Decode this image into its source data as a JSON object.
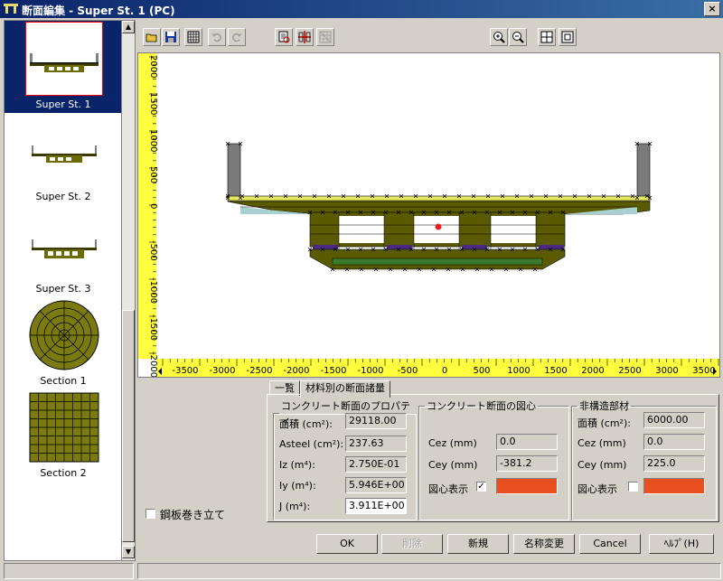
{
  "window": {
    "title": "断面編集 - Super St. 1 (PC)",
    "close": "×"
  },
  "sidebar": {
    "items": [
      {
        "label": "Super St. 1",
        "selected": true
      },
      {
        "label": "Super St. 2",
        "selected": false
      },
      {
        "label": "Super St. 3",
        "selected": false
      },
      {
        "label": "Section 1",
        "selected": false
      },
      {
        "label": "Section 2",
        "selected": false
      }
    ]
  },
  "toolbar": {
    "icons": [
      "open-icon",
      "save-icon",
      "grid-icon",
      "undo-icon",
      "redo-icon",
      "properties-icon",
      "center-icon",
      "mesh-icon",
      "zoom-in-icon",
      "zoom-out-icon",
      "fit-icon",
      "extent-icon"
    ]
  },
  "canvas": {
    "y_ruler": [
      "2000",
      "1500",
      "1000",
      "500",
      "0",
      "-500",
      "-1000",
      "-1500",
      "-2000"
    ],
    "x_ruler": [
      "-3500",
      "-3000",
      "-2500",
      "-2000",
      "-1500",
      "-1000",
      "-500",
      "0",
      "500",
      "1000",
      "1500",
      "2000",
      "2500",
      "3000",
      "3500"
    ]
  },
  "tabs": {
    "list": "一覧",
    "materials": "材料別の断面諸量"
  },
  "steel_wrap": {
    "label": "鋼板巻き立て",
    "checked": false
  },
  "concrete_props": {
    "legend": "コンクリート断面のプロパティ",
    "area_label": "面積 (cm²):",
    "area_value": "29118.00",
    "asteel_label": "Asteel (cm²):",
    "asteel_value": "237.63",
    "iz_label": "Iz (m⁴):",
    "iz_value": "2.750E-01",
    "iy_label": "Iy (m⁴):",
    "iy_value": "5.946E+00",
    "j_label": "J (m⁴):",
    "j_value": "3.911E+00"
  },
  "concrete_centroid": {
    "legend": "コンクリート断面の図心",
    "cez_label": "Cez (mm)",
    "cez_value": "0.0",
    "cey_label": "Cey (mm)",
    "cey_value": "-381.2",
    "show_label": "図心表示",
    "show_checked": true,
    "color": "#e85020"
  },
  "nonstructural": {
    "legend": "非構造部材",
    "area_label": "面積 (cm²):",
    "area_value": "6000.00",
    "cez_label": "Cez (mm)",
    "cez_value": "0.0",
    "cey_label": "Cey (mm)",
    "cey_value": "225.0",
    "show_label": "図心表示",
    "show_checked": false,
    "color": "#e85020"
  },
  "buttons": {
    "ok": "OK",
    "delete": "削除",
    "new": "新規",
    "rename": "名称変更",
    "cancel": "Cancel",
    "help": "ﾍﾙﾌﾟ(H)"
  }
}
